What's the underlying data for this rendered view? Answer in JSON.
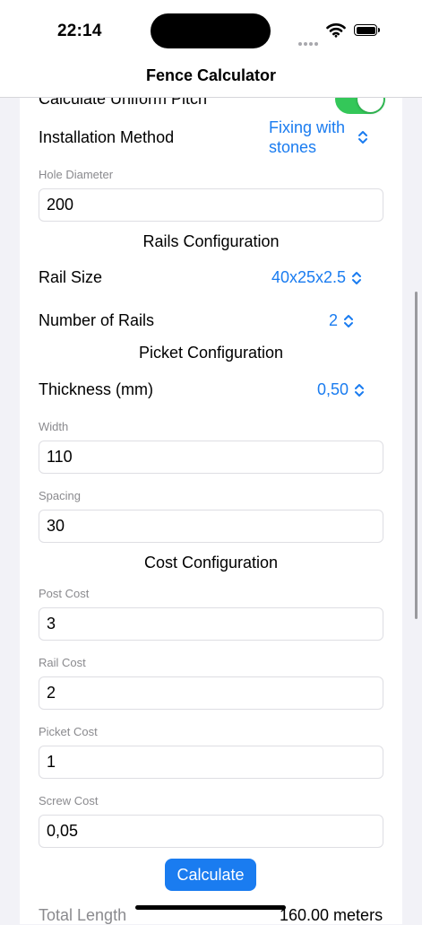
{
  "status_bar": {
    "time": "22:14"
  },
  "nav": {
    "title": "Fence Calculator"
  },
  "uniform_pitch": {
    "label": "Calculate Uniform Pitch",
    "enabled": true
  },
  "installation_method": {
    "label": "Installation Method",
    "value_line1": "Fixing with",
    "value_line2": "stones"
  },
  "hole_diameter": {
    "label": "Hole Diameter",
    "value": "200"
  },
  "rails_section": {
    "title": "Rails Configuration"
  },
  "rail_size": {
    "label": "Rail Size",
    "value": "40x25x2.5"
  },
  "number_of_rails": {
    "label": "Number of Rails",
    "value": "2"
  },
  "picket_section": {
    "title": "Picket Configuration"
  },
  "thickness": {
    "label": "Thickness (mm)",
    "value": "0,50"
  },
  "width": {
    "label": "Width",
    "value": "110"
  },
  "spacing": {
    "label": "Spacing",
    "value": "30"
  },
  "cost_section": {
    "title": "Cost Configuration"
  },
  "post_cost": {
    "label": "Post Cost",
    "value": "3"
  },
  "rail_cost": {
    "label": "Rail Cost",
    "value": "2"
  },
  "picket_cost": {
    "label": "Picket Cost",
    "value": "1"
  },
  "screw_cost": {
    "label": "Screw Cost",
    "value": "0,05"
  },
  "calculate": {
    "label": "Calculate"
  },
  "result": {
    "label": "Total Length",
    "value": "160.00 meters"
  },
  "colors": {
    "accent": "#1a7cf0",
    "toggle_on": "#34c759",
    "background": "#f2f2f7"
  }
}
